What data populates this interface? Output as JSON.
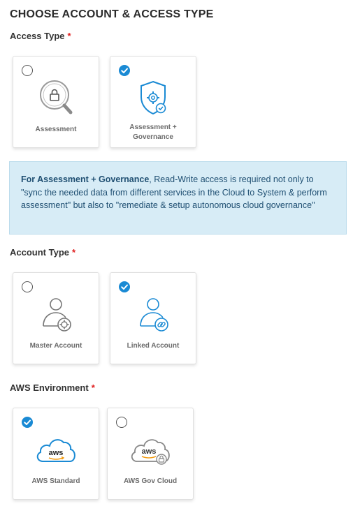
{
  "page_title": "CHOOSE ACCOUNT & ACCESS TYPE",
  "required_marker": "*",
  "access_type": {
    "label": "Access Type",
    "options": [
      {
        "label": "Assessment",
        "selected": false,
        "icon": "lock-magnifier-icon"
      },
      {
        "label": "Assessment + Governance",
        "selected": true,
        "icon": "shield-gear-icon"
      }
    ]
  },
  "info": {
    "bold": "For Assessment + Governance",
    "text": ", Read-Write access is required not only to \"sync the needed data from different services in the Cloud to System & perform assessment\" but also to \"remediate & setup autonomous cloud governance\""
  },
  "account_type": {
    "label": "Account Type",
    "options": [
      {
        "label": "Master Account",
        "selected": false,
        "icon": "user-gear-icon"
      },
      {
        "label": "Linked Account",
        "selected": true,
        "icon": "user-link-icon"
      }
    ]
  },
  "aws_environment": {
    "label": "AWS Environment",
    "options": [
      {
        "label": "AWS Standard",
        "selected": true,
        "icon": "aws-cloud-icon"
      },
      {
        "label": "AWS Gov Cloud",
        "selected": false,
        "icon": "aws-cloud-lock-icon"
      }
    ]
  },
  "aws_logo_text": "aws",
  "colors": {
    "accent": "#1a8ad4",
    "info_bg": "#d7ecf6",
    "info_text": "#1f4f72",
    "required": "#e02020",
    "aws_orange": "#f39c12"
  }
}
